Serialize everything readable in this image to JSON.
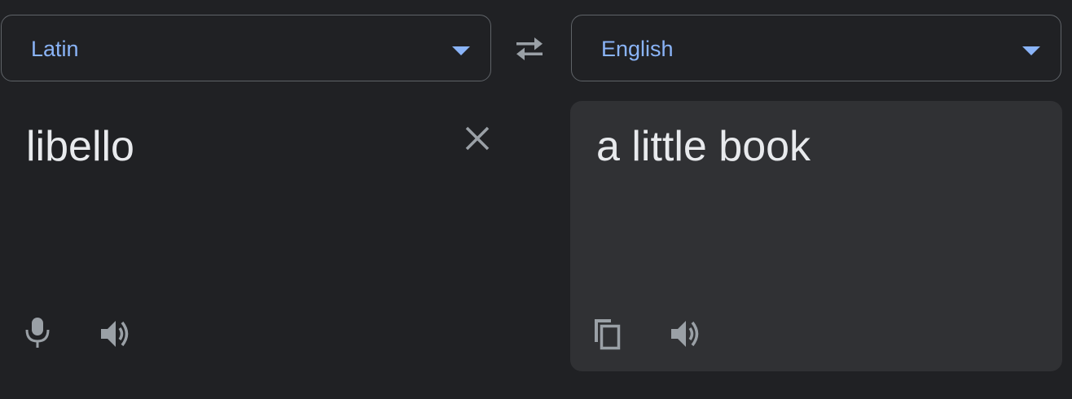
{
  "source_language": {
    "label": "Latin"
  },
  "target_language": {
    "label": "English"
  },
  "source": {
    "text": "libello"
  },
  "translation": {
    "text": "a little book"
  },
  "icons": {
    "swap": "swap-languages-icon",
    "clear": "close-icon",
    "mic": "microphone-icon",
    "source_listen": "speaker-icon",
    "copy": "copy-icon",
    "target_listen": "speaker-icon"
  },
  "colors": {
    "background": "#202124",
    "panel": "#303134",
    "accent": "#8ab4f8",
    "text": "#e8eaed",
    "icon": "#9aa0a6",
    "border": "#5f6368"
  }
}
